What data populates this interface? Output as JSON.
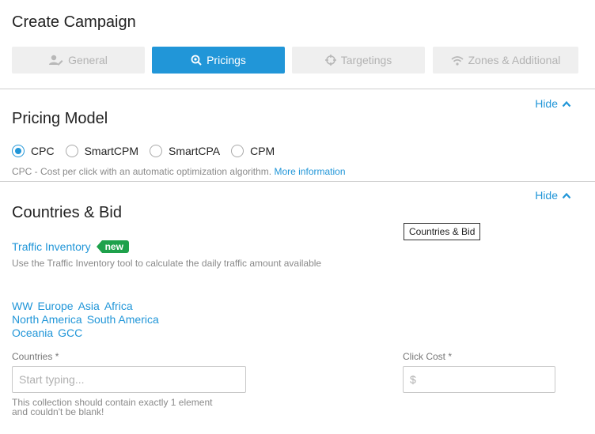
{
  "page": {
    "title": "Create Campaign"
  },
  "steps": [
    {
      "label": "General",
      "icon": "user-edit-icon",
      "active": false
    },
    {
      "label": "Pricings",
      "icon": "search-icon",
      "active": true
    },
    {
      "label": "Targetings",
      "icon": "crosshair-icon",
      "active": false
    },
    {
      "label": "Zones & Additional",
      "icon": "wifi-icon",
      "active": false
    }
  ],
  "pricing": {
    "title": "Pricing Model",
    "hide_label": "Hide",
    "options": [
      {
        "label": "CPC",
        "checked": true
      },
      {
        "label": "SmartCPM",
        "checked": false
      },
      {
        "label": "SmartCPA",
        "checked": false
      },
      {
        "label": "CPM",
        "checked": false
      }
    ],
    "hint": "CPC - Cost per click with an automatic optimization algorithm.",
    "more_info": "More information"
  },
  "countries": {
    "title": "Countries & Bid",
    "hide_label": "Hide",
    "tooltip": "Countries & Bid",
    "traffic_inventory": "Traffic Inventory",
    "badge": "new",
    "traffic_hint": "Use the Traffic Inventory tool to calculate the daily traffic amount available",
    "regions": [
      [
        "WW",
        "Europe",
        "Asia",
        "Africa"
      ],
      [
        "North America",
        "South America"
      ],
      [
        "Oceania",
        "GCC"
      ]
    ],
    "countries_label": "Countries *",
    "countries_placeholder": "Start typing...",
    "countries_value": "",
    "click_cost_label": "Click Cost *",
    "click_cost_placeholder": "$",
    "click_cost_value": "",
    "error_line1": "This collection should contain exactly 1 element",
    "error_line2": "and couldn't be blank!"
  },
  "colors": {
    "accent": "#2196d8",
    "badge": "#1ea14b",
    "inactive_step_bg": "#efefef"
  }
}
